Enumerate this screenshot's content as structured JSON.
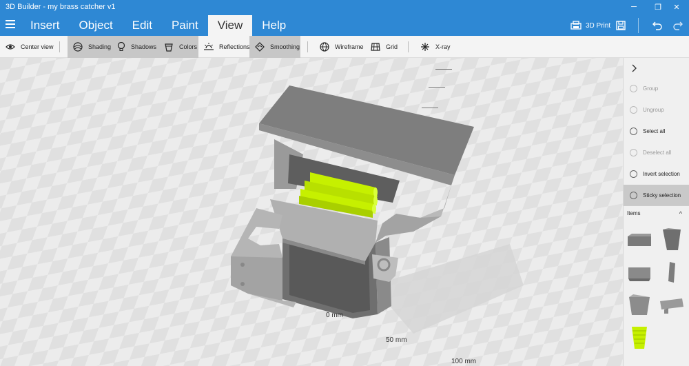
{
  "app": {
    "title": "3D Builder - my brass catcher v1"
  },
  "window_controls": {
    "minimize": "─",
    "restore": "❐",
    "close": "✕"
  },
  "menu": [
    {
      "label": "Insert"
    },
    {
      "label": "Object"
    },
    {
      "label": "Edit"
    },
    {
      "label": "Paint"
    },
    {
      "label": "View",
      "active": true
    },
    {
      "label": "Help"
    }
  ],
  "right_tools": {
    "print_label": "3D Print"
  },
  "ribbon": {
    "center_view": "Center view",
    "shading": "Shading",
    "shadows": "Shadows",
    "colors": "Colors",
    "reflections": "Reflections",
    "smoothing": "Smoothing",
    "wireframe": "Wireframe",
    "grid": "Grid",
    "xray": "X-ray"
  },
  "viewport": {
    "axis_labels": {
      "zero": "0 mm",
      "fifty": "50 mm",
      "hundred": "100 mm"
    },
    "accent_color": "#c6f000"
  },
  "right_panel": {
    "group": "Group",
    "ungroup": "Ungroup",
    "select_all": "Select all",
    "deselect_all": "Deselect all",
    "invert_selection": "Invert selection",
    "sticky_selection": "Sticky selection",
    "items_header": "Items"
  },
  "colors": {
    "titlebar": "#2e88d4",
    "model_gray": "#8c8c8c",
    "highlight": "#c6f000"
  }
}
